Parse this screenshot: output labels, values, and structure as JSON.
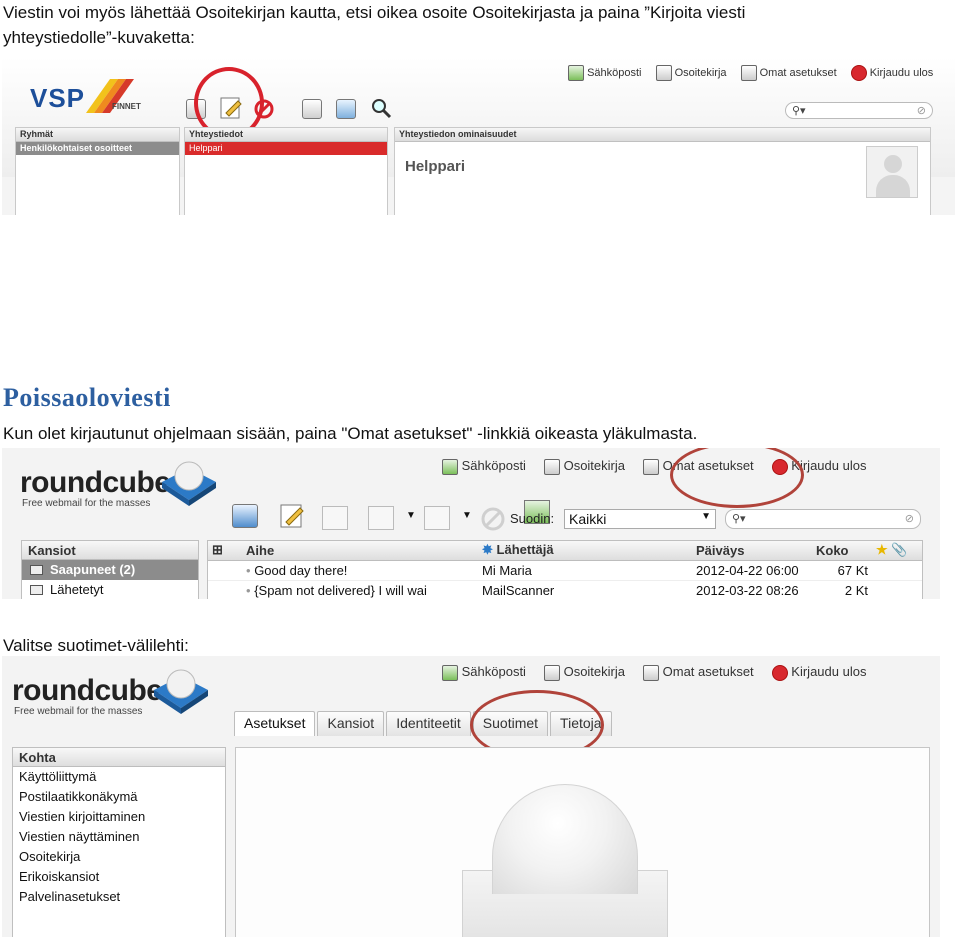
{
  "text": {
    "para1_line1": "Viestin voi myös lähettää Osoitekirjan kautta, etsi oikea osoite Osoitekirjasta ja paina ”Kirjoita viesti",
    "para1_line2": "yhteystiedolle”-kuvaketta:",
    "heading": "Poissaoloviesti",
    "para2": "Kun olet kirjautunut ohjelmaan sisään, paina \"Omat asetukset\" -linkkiä oikeasta yläkulmasta.",
    "para3": "Valitse suotimet-välilehti:"
  },
  "shot1": {
    "logo": "VSP",
    "logo_sub": "FINNET",
    "menu": [
      "Sähköposti",
      "Osoitekirja",
      "Omat asetukset",
      "Kirjaudu ulos"
    ],
    "panels": {
      "groups_header": "Ryhmät",
      "groups_row": "Henkilökohtaiset osoitteet",
      "contacts_header": "Yhteystiedot",
      "contacts_row": "Helppari",
      "details_header": "Yhteystiedon ominaisuudet",
      "details_name": "Helppari"
    },
    "colors": {
      "selected_row": "#d92b2b",
      "highlight_circle": "#d8222c"
    }
  },
  "shot2": {
    "logo": "roundcube",
    "tagline": "Free webmail for the masses",
    "menu": [
      "Sähköposti",
      "Osoitekirja",
      "Omat asetukset",
      "Kirjaudu ulos"
    ],
    "filter_label": "Suodin:",
    "filter_value": "Kaikki",
    "folders_header": "Kansiot",
    "folders": [
      "Saapuneet (2)",
      "Lähetetyt"
    ],
    "columns": [
      "Aihe",
      "Lähettäjä",
      "Päiväys",
      "Koko"
    ],
    "messages": [
      {
        "subject": "Good day there!",
        "from": "Mi Maria",
        "date": "2012-04-22 06:00",
        "size": "67 Kt"
      },
      {
        "subject": "{Spam not delivered} I will wai",
        "from": "MailScanner",
        "date": "2012-03-22 08:26",
        "size": "2 Kt"
      }
    ]
  },
  "shot3": {
    "logo": "roundcube",
    "tagline": "Free webmail for the masses",
    "menu": [
      "Sähköposti",
      "Osoitekirja",
      "Omat asetukset",
      "Kirjaudu ulos"
    ],
    "tabs": [
      "Asetukset",
      "Kansiot",
      "Identiteetit",
      "Suotimet",
      "Tietoja"
    ],
    "list_header": "Kohta",
    "items": [
      "Käyttöliittymä",
      "Postilaatikkonäkymä",
      "Viestien kirjoittaminen",
      "Viestien näyttäminen",
      "Osoitekirja",
      "Erikoiskansiot",
      "Palvelinasetukset"
    ]
  }
}
